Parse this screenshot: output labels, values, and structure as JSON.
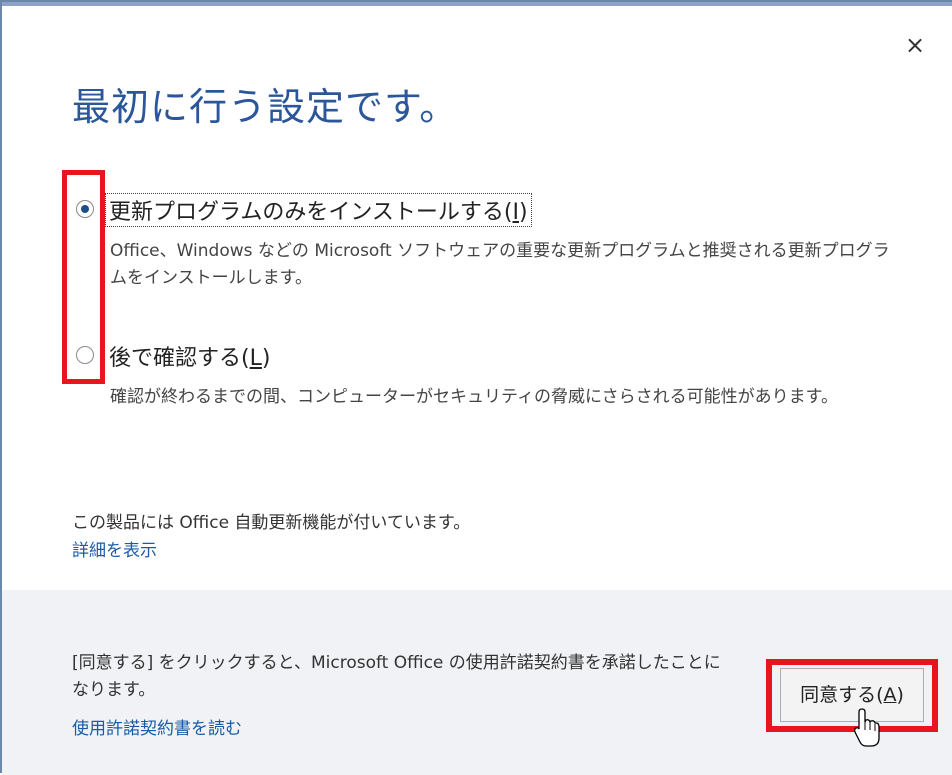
{
  "dialog": {
    "close_symbol": "×",
    "title": "最初に行う設定です。"
  },
  "options": [
    {
      "label": "更新プログラムのみをインストールする",
      "accel_open": "(",
      "accel_key": "I",
      "accel_close": ")",
      "selected": true,
      "description": "Office、Windows などの Microsoft ソフトウェアの重要な更新プログラムと推奨される更新プログラムをインストールします。"
    },
    {
      "label": "後で確認する",
      "accel_open": "(",
      "accel_key": "L",
      "accel_close": ")",
      "selected": false,
      "description": "確認が終わるまでの間、コンピューターがセキュリティの脅威にさらされる可能性があります。"
    }
  ],
  "auto_update": {
    "text": "この製品には Office 自動更新機能が付いています。",
    "link": "詳細を表示"
  },
  "footer": {
    "license_text": "[同意する] をクリックすると、Microsoft Office の使用許諾契約書を承諾したことになります。",
    "license_link": "使用許諾契約書を読む",
    "agree_label": "同意する",
    "agree_accel_open": "(",
    "agree_accel_key": "A",
    "agree_accel_close": ")"
  },
  "colors": {
    "title": "#2b579a",
    "link": "#1a5ba6",
    "highlight_box": "#e8141e",
    "footer_bg": "#f0f2f5"
  },
  "icons": {
    "close": "close-icon",
    "cursor": "mouse-pointer-icon"
  }
}
